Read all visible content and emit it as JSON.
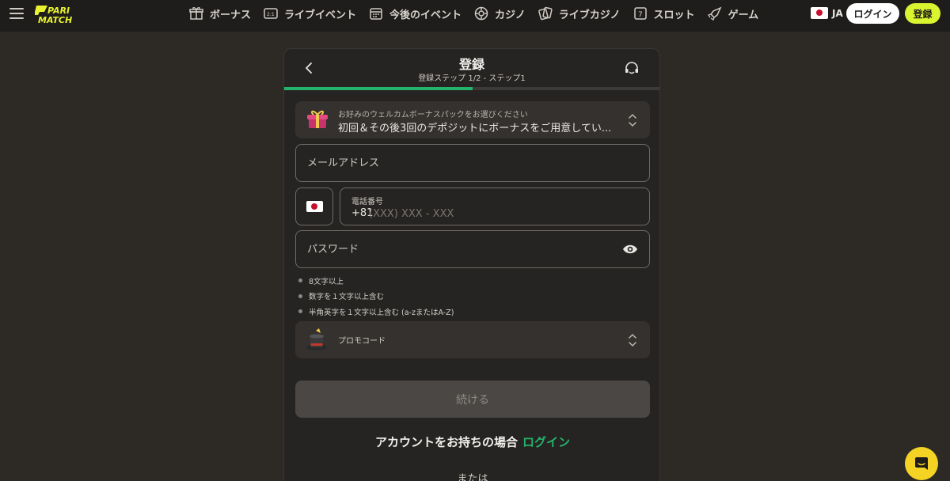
{
  "header": {
    "logo_text": "PARIMATCH",
    "nav": [
      {
        "label": "ボーナス",
        "icon": "gift-icon"
      },
      {
        "label": "ライブイベント",
        "icon": "live-icon"
      },
      {
        "label": "今後のイベント",
        "icon": "calendar-icon"
      },
      {
        "label": "カジノ",
        "icon": "casino-chip-icon"
      },
      {
        "label": "ライブカジノ",
        "icon": "cards-icon"
      },
      {
        "label": "スロット",
        "icon": "slot-icon"
      },
      {
        "label": "ゲーム",
        "icon": "rocket-icon"
      }
    ],
    "language": "JA",
    "login_label": "ログイン",
    "register_label": "登録"
  },
  "modal": {
    "title": "登録",
    "subtitle": "登録ステップ 1/2 - ステップ1",
    "progress": 0.5,
    "bonus": {
      "label": "お好みのウェルカムボーナスパックをお選びください",
      "value": "初回＆その後3回のデポジットにボーナスをご用意してい..."
    },
    "email": {
      "placeholder": "メールアドレス"
    },
    "phone": {
      "label": "電話番号",
      "code": "+81",
      "placeholder": "(XXX) XXX - XXX"
    },
    "password": {
      "placeholder": "パスワード"
    },
    "rules": [
      "8文字以上",
      "数字を１文字以上含む",
      "半角英字を１文字以上含む (a-zまたはA-Z)"
    ],
    "promo": {
      "label": "プロモコード"
    },
    "continue_label": "続ける",
    "have_account": "アカウントをお持ちの場合",
    "login_link": "ログイン",
    "or": "または"
  },
  "colors": {
    "accent_green": "#24b36b",
    "accent_yellow": "#d9f530",
    "chat_yellow": "#f4d324",
    "background": "#2d2924"
  }
}
